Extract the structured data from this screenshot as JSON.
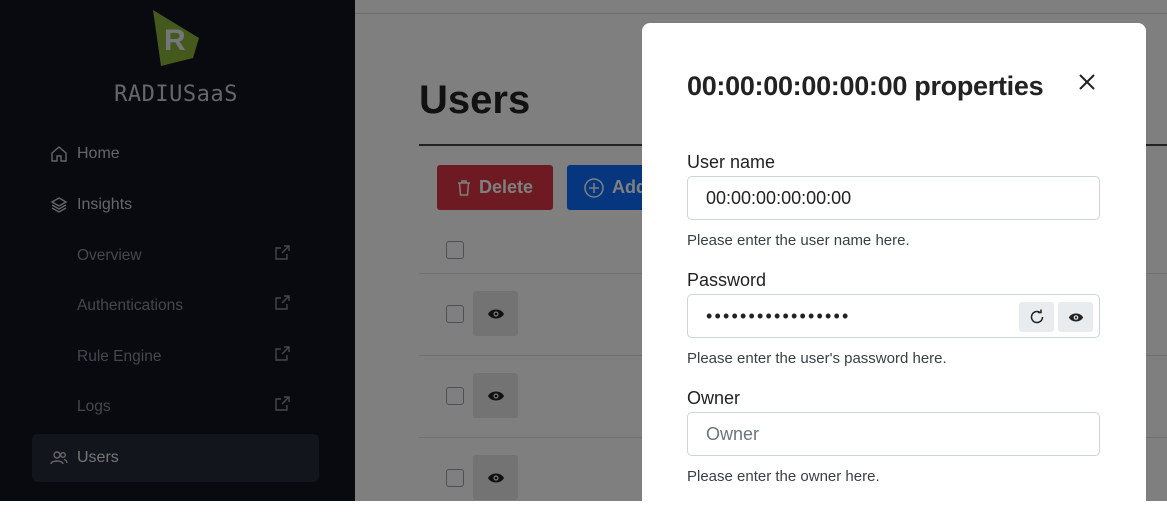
{
  "sidebar": {
    "logo_letter": "R",
    "app_name": "RADIUSaaS",
    "items": [
      {
        "label": "Home"
      },
      {
        "label": "Insights"
      },
      {
        "label": "Overview"
      },
      {
        "label": "Authentications"
      },
      {
        "label": "Rule Engine"
      },
      {
        "label": "Logs"
      },
      {
        "label": "Users"
      }
    ]
  },
  "main": {
    "title": "Users",
    "delete_label": "Delete",
    "add_label": "Add"
  },
  "modal": {
    "title": "00:00:00:00:00:00 properties",
    "username": {
      "label": "User name",
      "value": "00:00:00:00:00:00",
      "hint": "Please enter the user name here."
    },
    "password": {
      "label": "Password",
      "masked_value": "•••••••••••••••••",
      "hint": "Please enter the user's password here."
    },
    "owner": {
      "label": "Owner",
      "placeholder": "Owner",
      "value": "",
      "hint": "Please enter the owner here."
    }
  },
  "colors": {
    "sidebar_bg": "#101421",
    "logo_green": "#8db33b",
    "danger": "#dc3545",
    "primary": "#0d6efd"
  }
}
